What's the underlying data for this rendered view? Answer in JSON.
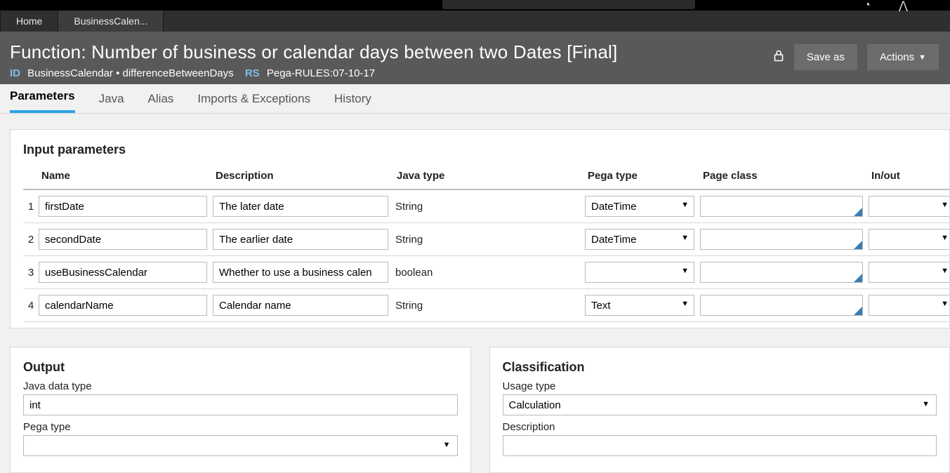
{
  "top": {
    "tabs": [
      {
        "label": "Home"
      },
      {
        "label": "BusinessCalen..."
      }
    ]
  },
  "header": {
    "title": "Function: Number of business or calendar days between two Dates [Final]",
    "id_kw": "ID",
    "id_value": "BusinessCalendar • differenceBetweenDays",
    "rs_kw": "RS",
    "rs_value": "Pega-RULES:07-10-17",
    "save_as": "Save as",
    "actions": "Actions"
  },
  "ruletabs": [
    "Parameters",
    "Java",
    "Alias",
    "Imports & Exceptions",
    "History"
  ],
  "params_section": {
    "heading": "Input parameters",
    "columns": {
      "name": "Name",
      "description": "Description",
      "java_type": "Java type",
      "pega_type": "Pega type",
      "page_class": "Page class",
      "in_out": "In/out"
    },
    "rows": [
      {
        "idx": "1",
        "name": "firstDate",
        "description": "The later date",
        "java_type": "String",
        "pega_type": "DateTime"
      },
      {
        "idx": "2",
        "name": "secondDate",
        "description": "The earlier date",
        "java_type": "String",
        "pega_type": "DateTime"
      },
      {
        "idx": "3",
        "name": "useBusinessCalendar",
        "description": "Whether to use a business calen",
        "java_type": "boolean",
        "pega_type": ""
      },
      {
        "idx": "4",
        "name": "calendarName",
        "description": "Calendar name",
        "java_type": "String",
        "pega_type": "Text"
      }
    ]
  },
  "output": {
    "heading": "Output",
    "java_data_type_label": "Java data type",
    "java_data_type_value": "int",
    "pega_type_label": "Pega type",
    "pega_type_value": ""
  },
  "classification": {
    "heading": "Classification",
    "usage_type_label": "Usage type",
    "usage_type_value": "Calculation",
    "description_label": "Description",
    "description_value": ""
  }
}
